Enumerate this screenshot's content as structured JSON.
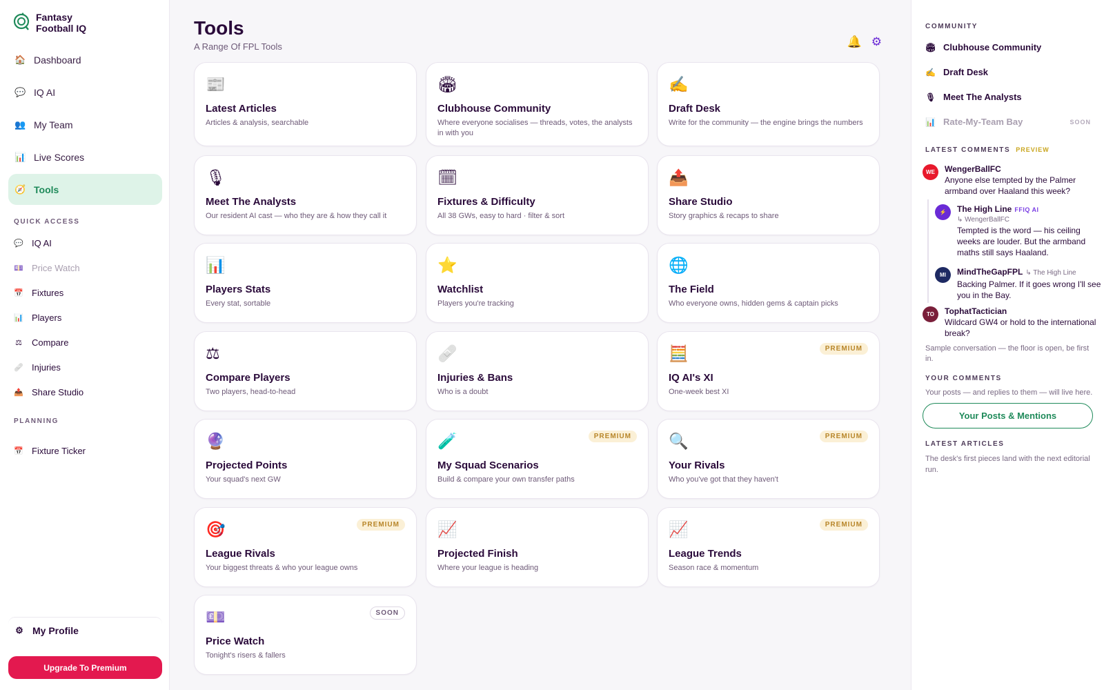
{
  "brand": {
    "name": "Fantasy Football IQ"
  },
  "nav": [
    {
      "label": "Dashboard",
      "icon": "🏠",
      "icon_name": "house-icon"
    },
    {
      "label": "IQ AI",
      "icon": "💬",
      "icon_name": "speech-bubble-icon"
    },
    {
      "label": "My Team",
      "icon": "👥",
      "icon_name": "people-icon"
    },
    {
      "label": "Live Scores",
      "icon": "📊",
      "icon_name": "bar-chart-icon"
    },
    {
      "label": "Tools",
      "icon": "🧭",
      "icon_name": "compass-icon",
      "active": true
    }
  ],
  "quick_access": {
    "title": "QUICK ACCESS",
    "items": [
      {
        "label": "IQ AI",
        "icon": "💬",
        "icon_name": "speech-bubble-icon"
      },
      {
        "label": "Price Watch",
        "icon": "💷",
        "icon_name": "banknote-icon",
        "muted": true
      },
      {
        "label": "Fixtures",
        "icon": "📅",
        "icon_name": "calendar-icon"
      },
      {
        "label": "Players",
        "icon": "📊",
        "icon_name": "bar-chart-icon"
      },
      {
        "label": "Compare",
        "icon": "⚖",
        "icon_name": "scales-icon"
      },
      {
        "label": "Injuries",
        "icon": "🩹",
        "icon_name": "bandage-icon"
      },
      {
        "label": "Share Studio",
        "icon": "📤",
        "icon_name": "outbox-icon"
      }
    ]
  },
  "planning": {
    "title": "PLANNING",
    "items": [
      {
        "label": "Fixture Ticker",
        "icon": "📅",
        "icon_name": "calendar-icon"
      }
    ]
  },
  "profile": {
    "label": "My Profile",
    "icon": "⚙",
    "icon_name": "gear-icon"
  },
  "upgrade": {
    "label": "Upgrade To Premium"
  },
  "header": {
    "title": "Tools",
    "subtitle": "A Range Of FPL Tools",
    "bell_icon": "🔔",
    "gear_icon": "⚙"
  },
  "cards": [
    {
      "title": "Latest Articles",
      "desc": "Articles & analysis, searchable",
      "icon": "📰",
      "icon_name": "newspaper-icon",
      "badge": ""
    },
    {
      "title": "Clubhouse Community",
      "desc": "Where everyone socialises — threads, votes, the analysts in with you",
      "icon": "🏟",
      "icon_name": "stadium-icon",
      "badge": ""
    },
    {
      "title": "Draft Desk",
      "desc": "Write for the community — the engine brings the numbers",
      "icon": "✍",
      "icon_name": "writing-hand-icon",
      "badge": ""
    },
    {
      "title": "Meet The Analysts",
      "desc": "Our resident AI cast — who they are & how they call it",
      "icon": "🎙",
      "icon_name": "microphone-icon",
      "badge": ""
    },
    {
      "title": "Fixtures & Difficulty",
      "desc": "All 38 GWs, easy to hard · filter & sort",
      "icon": "🗓",
      "icon_name": "calendar-icon",
      "badge": ""
    },
    {
      "title": "Share Studio",
      "desc": "Story graphics & recaps to share",
      "icon": "📤",
      "icon_name": "outbox-icon",
      "badge": ""
    },
    {
      "title": "Players Stats",
      "desc": "Every stat, sortable",
      "icon": "📊",
      "icon_name": "bar-chart-icon",
      "badge": ""
    },
    {
      "title": "Watchlist",
      "desc": "Players you're tracking",
      "icon": "⭐",
      "icon_name": "star-icon",
      "badge": ""
    },
    {
      "title": "The Field",
      "desc": "Who everyone owns, hidden gems & captain picks",
      "icon": "🌐",
      "icon_name": "globe-icon",
      "badge": ""
    },
    {
      "title": "Compare Players",
      "desc": "Two players, head-to-head",
      "icon": "⚖",
      "icon_name": "scales-icon",
      "badge": ""
    },
    {
      "title": "Injuries & Bans",
      "desc": "Who is a doubt",
      "icon": "🩹",
      "icon_name": "bandage-icon",
      "badge": ""
    },
    {
      "title": "IQ AI's XI",
      "desc": "One-week best XI",
      "icon": "🧮",
      "icon_name": "abacus-icon",
      "badge": "PREMIUM",
      "badge_kind": "premium"
    },
    {
      "title": "Projected Points",
      "desc": "Your squad's next GW",
      "icon": "🔮",
      "icon_name": "crystal-ball-icon",
      "badge": ""
    },
    {
      "title": "My Squad Scenarios",
      "desc": "Build & compare your own transfer paths",
      "icon": "🧪",
      "icon_name": "test-tube-icon",
      "badge": "PREMIUM",
      "badge_kind": "premium"
    },
    {
      "title": "Your Rivals",
      "desc": "Who you've got that they haven't",
      "icon": "🔍",
      "icon_name": "magnifier-icon",
      "badge": "PREMIUM",
      "badge_kind": "premium"
    },
    {
      "title": "League Rivals",
      "desc": "Your biggest threats & who your league owns",
      "icon": "🎯",
      "icon_name": "target-icon",
      "badge": "PREMIUM",
      "badge_kind": "premium"
    },
    {
      "title": "Projected Finish",
      "desc": "Where your league is heading",
      "icon": "📈",
      "icon_name": "trend-chart-icon",
      "badge": ""
    },
    {
      "title": "League Trends",
      "desc": "Season race & momentum",
      "icon": "📈",
      "icon_name": "trend-chart-icon",
      "badge": "PREMIUM",
      "badge_kind": "premium"
    },
    {
      "title": "Price Watch",
      "desc": "Tonight's risers & fallers",
      "icon": "💷",
      "icon_name": "banknote-icon",
      "badge": "SOON",
      "badge_kind": "soon"
    }
  ],
  "right": {
    "community_title": "COMMUNITY",
    "community": [
      {
        "label": "Clubhouse Community",
        "icon": "🏟",
        "icon_name": "stadium-icon"
      },
      {
        "label": "Draft Desk",
        "icon": "✍",
        "icon_name": "writing-hand-icon"
      },
      {
        "label": "Meet The Analysts",
        "icon": "🎙",
        "icon_name": "microphone-icon"
      },
      {
        "label": "Rate-My-Team Bay",
        "icon": "📊",
        "icon_name": "bar-chart-icon",
        "muted": true,
        "soon": "SOON"
      }
    ],
    "latest_comments_title": "LATEST COMMENTS",
    "preview_label": "PREVIEW",
    "comments": [
      {
        "initials": "WE",
        "color": "#e8192c",
        "name": "WengerBallFC",
        "tag": "",
        "reply_to": "",
        "text": "Anyone else tempted by the Palmer armband over Haaland this week?"
      },
      {
        "initials": "⚡",
        "color": "#6a2bd6",
        "name": "The High Line",
        "tag": "FFIQ AI",
        "reply_to": "↳ WengerBallFC",
        "text": "Tempted is the word — his ceiling weeks are louder. But the armband maths still says Haaland."
      },
      {
        "initials": "MI",
        "color": "#1e2a63",
        "name": "MindTheGapFPL",
        "tag": "",
        "reply_to": "↳ The High Line",
        "text": "Backing Palmer. If it goes wrong I'll see you in the Bay."
      },
      {
        "initials": "TO",
        "color": "#7a1f3a",
        "name": "TophatTactician",
        "tag": "",
        "reply_to": "",
        "text": "Wildcard GW4 or hold to the international break?"
      }
    ],
    "sample_text": "Sample conversation — the floor is open, be first in.",
    "your_comments_title": "YOUR COMMENTS",
    "your_comments_text": "Your posts — and replies to them — will live here.",
    "posts_button": "Your Posts & Mentions",
    "latest_articles_title": "LATEST ARTICLES",
    "latest_articles_text": "The desk's first pieces land with the next editorial run."
  },
  "colors": {
    "accent_green": "#1f8a5a",
    "upgrade_red": "#e3194f",
    "premium_gold": "#b8862a",
    "ink": "#2a0a3a"
  }
}
